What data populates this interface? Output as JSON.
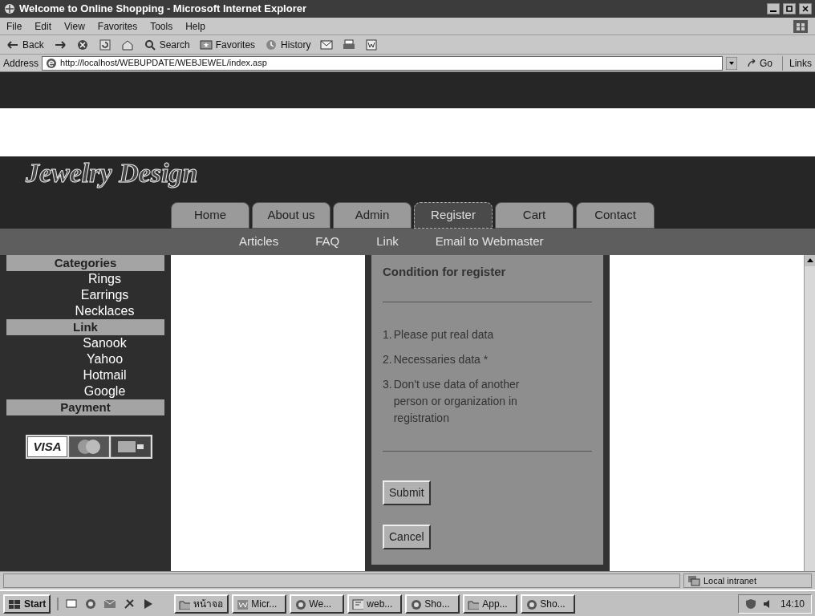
{
  "window": {
    "title": "Welcome to Online Shopping - Microsoft Internet Explorer"
  },
  "menu": [
    "File",
    "Edit",
    "View",
    "Favorites",
    "Tools",
    "Help"
  ],
  "toolbar": [
    {
      "kind": "back",
      "label": "Back"
    },
    {
      "kind": "forward"
    },
    {
      "kind": "stop"
    },
    {
      "kind": "refresh"
    },
    {
      "kind": "home"
    },
    {
      "kind": "search",
      "label": "Search"
    },
    {
      "kind": "favorites",
      "label": "Favorites"
    },
    {
      "kind": "history",
      "label": "History"
    },
    {
      "kind": "mail"
    },
    {
      "kind": "print"
    },
    {
      "kind": "edit"
    }
  ],
  "address": {
    "label": "Address",
    "url": "http://localhost/WEBUPDATE/WEBJEWEL/index.asp",
    "go": "Go",
    "links": "Links"
  },
  "site": {
    "logo": "Jewelry Design",
    "tabs": [
      {
        "label": "Home",
        "selected": false
      },
      {
        "label": "About us",
        "selected": false
      },
      {
        "label": "Admin",
        "selected": false
      },
      {
        "label": "Register",
        "selected": true
      },
      {
        "label": "Cart",
        "selected": false
      },
      {
        "label": "Contact",
        "selected": false
      }
    ],
    "subnav": [
      "Articles",
      "FAQ",
      "Link",
      "Email to Webmaster"
    ],
    "sidebar": [
      {
        "heading": "Categories",
        "items": [
          "Rings",
          "Earrings",
          "Necklaces"
        ]
      },
      {
        "heading": "Link",
        "items": [
          "Sanook",
          "Yahoo",
          "Hotmail",
          "Google"
        ]
      },
      {
        "heading": "Payment"
      }
    ],
    "payment_cards": [
      {
        "kind": "visa",
        "label": "VISA"
      },
      {
        "kind": "mastercard"
      },
      {
        "kind": "amex"
      }
    ],
    "register": {
      "title": "Condition for register",
      "conditions": [
        {
          "number": "1.",
          "text": "Please put real data"
        },
        {
          "number": "2.",
          "text": "Necessaries data *"
        },
        {
          "number": "3.",
          "text": "Don't use data of another person or organization in registration"
        }
      ],
      "buttons": [
        "Submit",
        "Cancel"
      ]
    }
  },
  "status_bar": {
    "zone": "Local intranet"
  },
  "taskbar": {
    "start": "Start",
    "quick_launch": [
      {
        "kind": "desktop"
      },
      {
        "kind": "ie"
      },
      {
        "kind": "outlook"
      },
      {
        "kind": "channels"
      },
      {
        "kind": "media"
      }
    ],
    "tasks": [
      {
        "kind": "folder",
        "label": "หน้าจอ"
      },
      {
        "kind": "word",
        "label": "Micr..."
      },
      {
        "kind": "ie",
        "label": "We..."
      },
      {
        "kind": "frontpage",
        "label": "web..."
      },
      {
        "kind": "ie",
        "label": "Sho..."
      },
      {
        "kind": "folder",
        "label": "App..."
      },
      {
        "kind": "ie",
        "label": "Sho..."
      }
    ],
    "clock": "14:10"
  }
}
